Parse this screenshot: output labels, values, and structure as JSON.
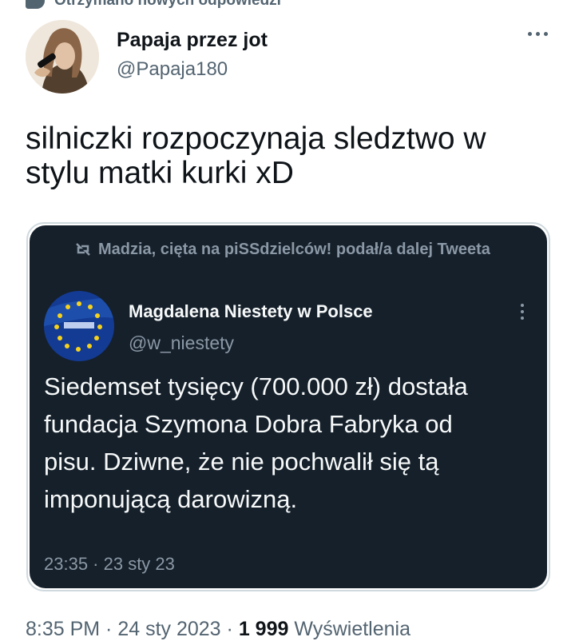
{
  "notification": {
    "text": "Otrzymano nowych odpowiedzi",
    "icon": "message-bubble-icon"
  },
  "author": {
    "display_name": "Papaja przez jot",
    "handle": "@Papaja180",
    "avatar_icon": "profile-photo-avatar"
  },
  "tweet": {
    "text": "silniczki rozpoczynaja sledztwo w stylu matki kurki xD"
  },
  "quoted": {
    "retweet_text": "Madzia, cięta na piSSdzielców! podał/a dalej Tweeta",
    "display_name": "Magdalena Niestety w Polsce",
    "handle": "@w_niestety",
    "text": "Siedemset tysięcy (700.000 zł) dostała fundacja Szymona Dobra Fabryka od pisu. Dziwne, że nie pochwalił się tą imponującą darowizną.",
    "timestamp": "23:35 · 23 sty 23",
    "avatar_icon": "eu-flag-avatar"
  },
  "footer": {
    "time": "8:35 PM · 24 sty 2023 ·",
    "views_count": "1 999",
    "views_label": "Wyświetlenia"
  },
  "colors": {
    "text": "#0f1419",
    "secondary": "#536471",
    "quote_bg": "#15202b",
    "quote_secondary": "#8b98a5"
  }
}
